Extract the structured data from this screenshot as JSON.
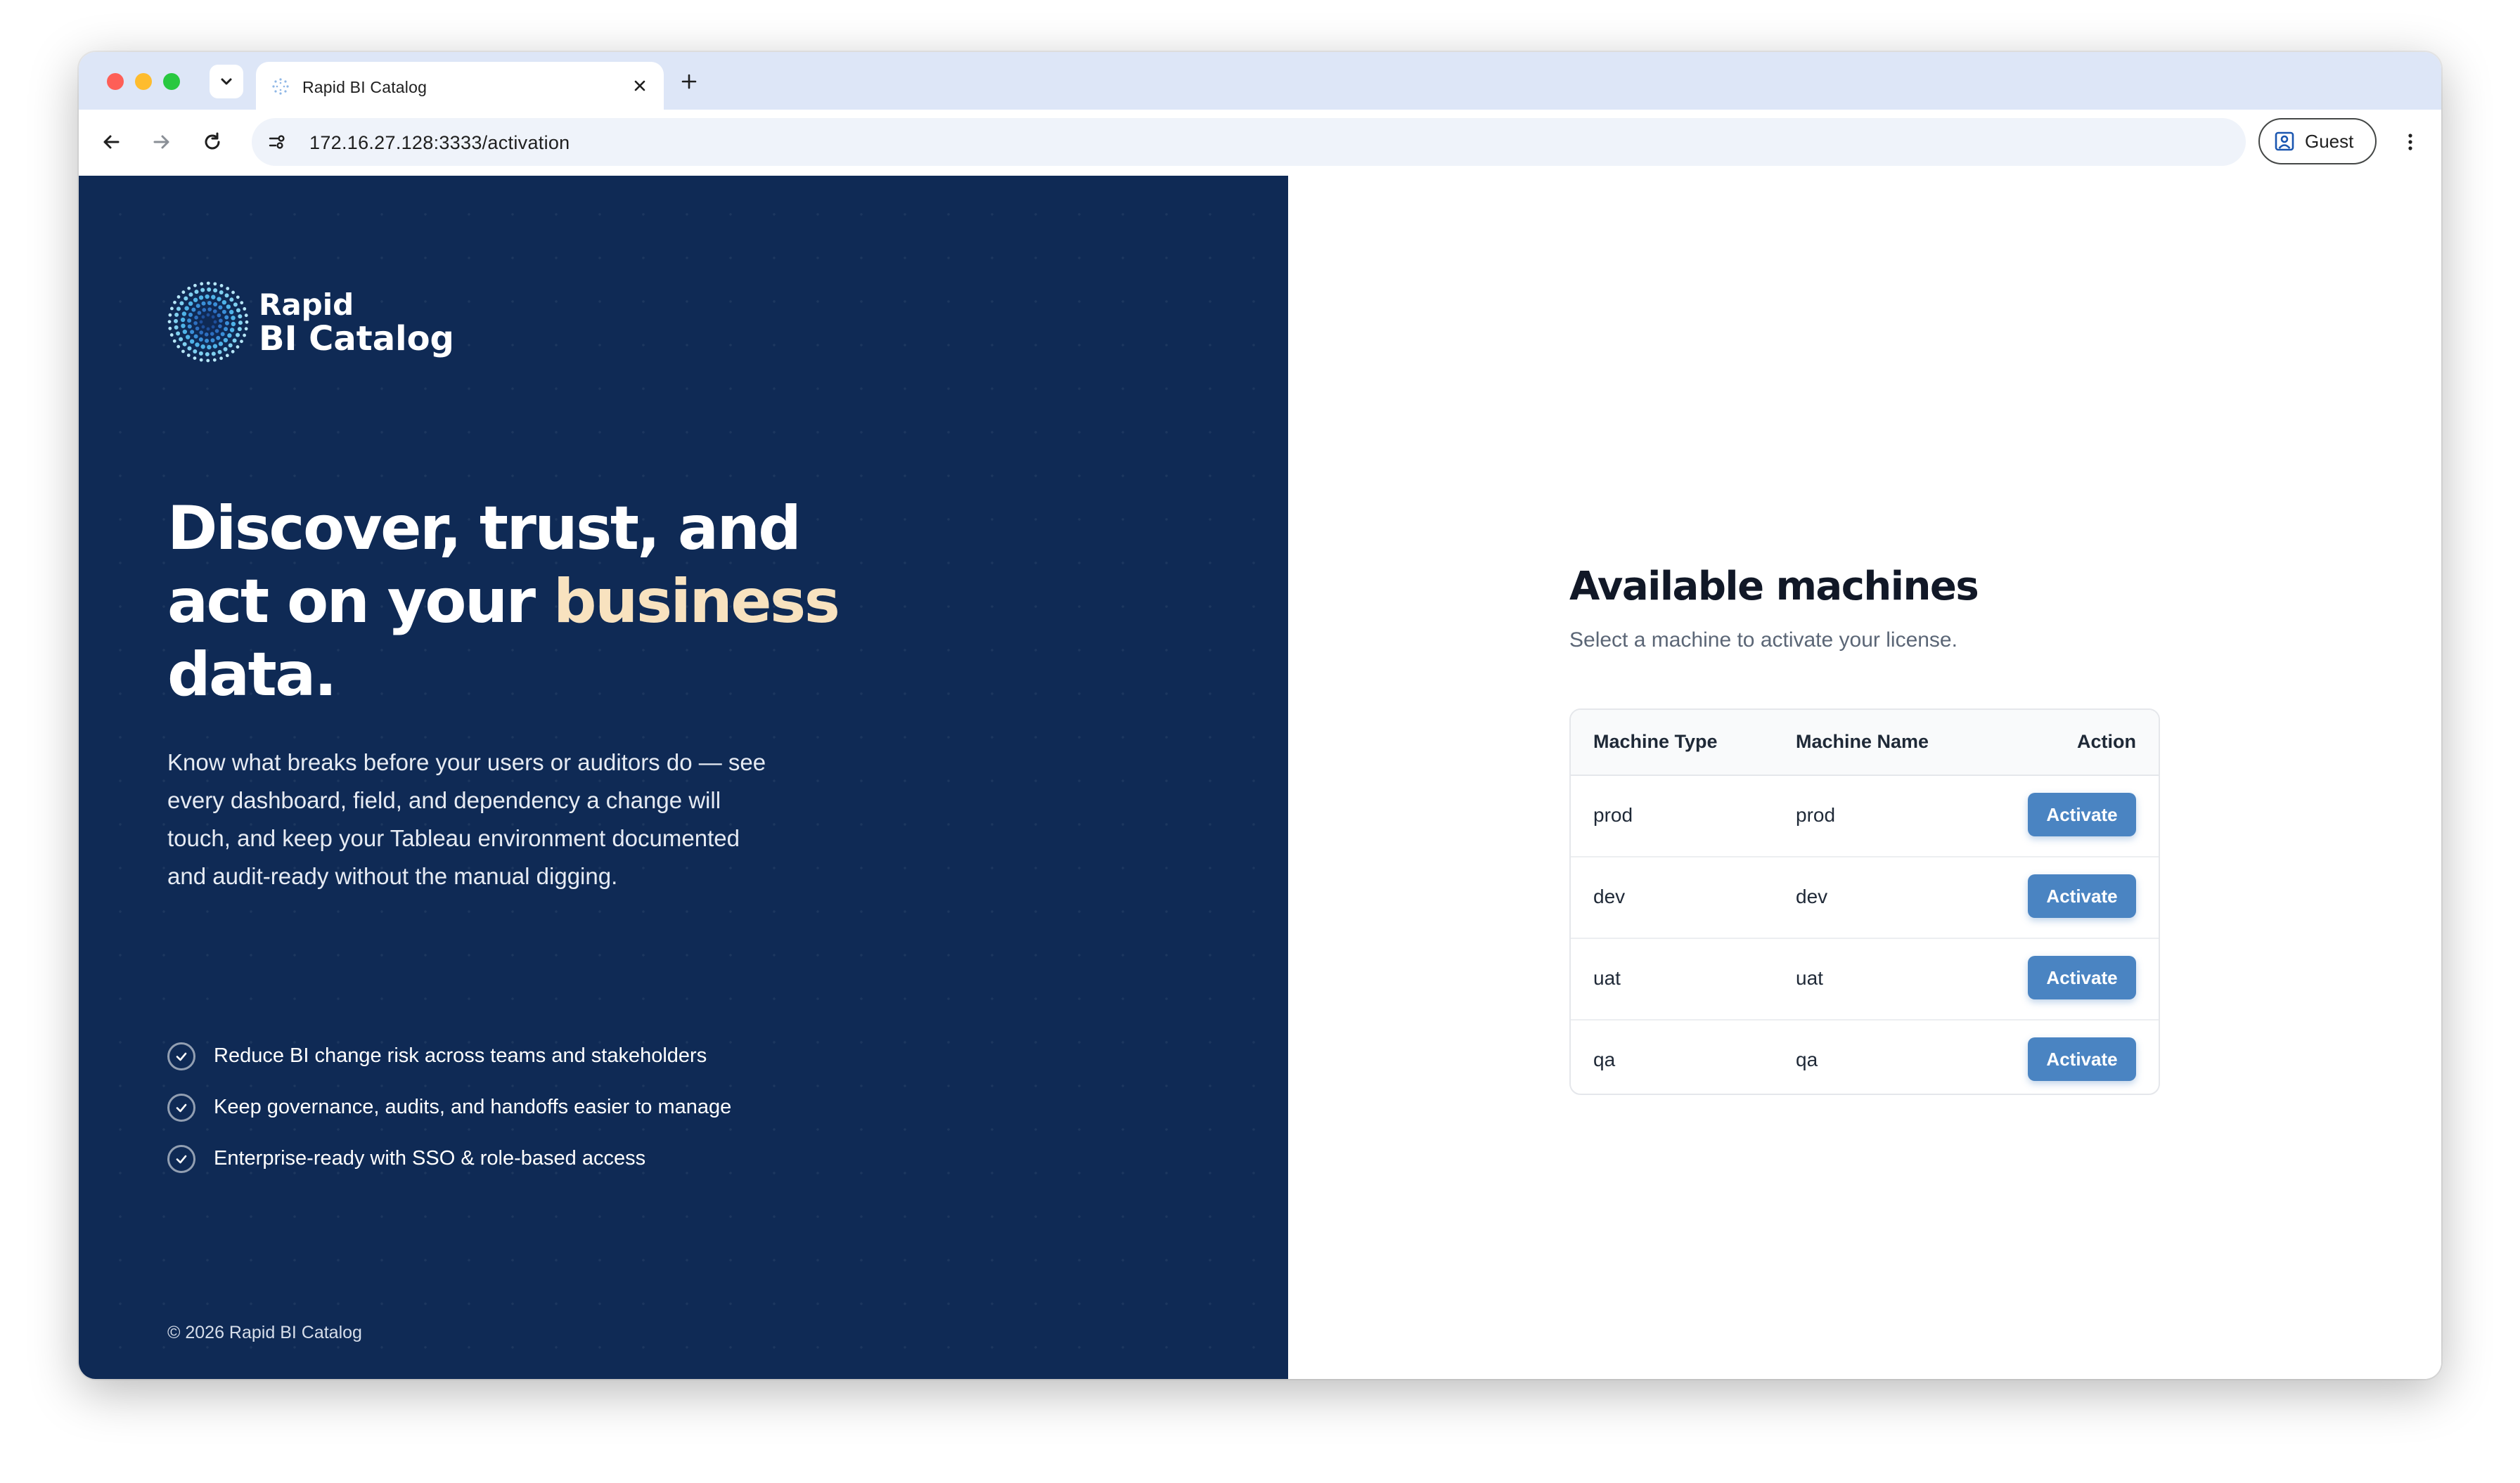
{
  "browser": {
    "tab_title": "Rapid BI Catalog",
    "url": "172.16.27.128:3333/activation",
    "profile_label": "Guest",
    "icons": [
      "tab-search-icon",
      "close-icon",
      "plus-icon",
      "back-arrow-icon",
      "forward-arrow-icon",
      "reload-icon",
      "site-info-icon",
      "guest-profile-icon",
      "more-vert-icon"
    ]
  },
  "brand": {
    "line1": "Rapid",
    "line2": "BI Catalog",
    "icon": "burst-logo-icon"
  },
  "hero": {
    "headline_part1": "Discover, trust, and act on your ",
    "headline_accent": "business",
    "headline_part2": " data.",
    "lead": "Know what breaks before your users or auditors do — see every dashboard, field, and dependency a change will touch, and keep your Tableau environment documented and audit-ready without the manual digging."
  },
  "benefits": [
    "Reduce BI change risk across teams and stakeholders",
    "Keep governance, audits, and handoffs easier to manage",
    "Enterprise-ready with SSO & role-based access"
  ],
  "footer": {
    "copyright": "© 2026 Rapid BI Catalog"
  },
  "machines": {
    "title": "Available machines",
    "subtitle": "Select a machine to activate your license.",
    "columns": [
      "Machine Type",
      "Machine Name",
      "Action"
    ],
    "rows": [
      {
        "type": "prod",
        "name": "prod",
        "action": "Activate"
      },
      {
        "type": "dev",
        "name": "dev",
        "action": "Activate"
      },
      {
        "type": "uat",
        "name": "uat",
        "action": "Activate"
      },
      {
        "type": "qa",
        "name": "qa",
        "action": "Activate"
      }
    ]
  },
  "colors": {
    "panel_navy": "#0f2a55",
    "accent_cream": "#f8e2bf",
    "button_blue": "#4a84c2",
    "tabstrip": "#dde6f7"
  }
}
